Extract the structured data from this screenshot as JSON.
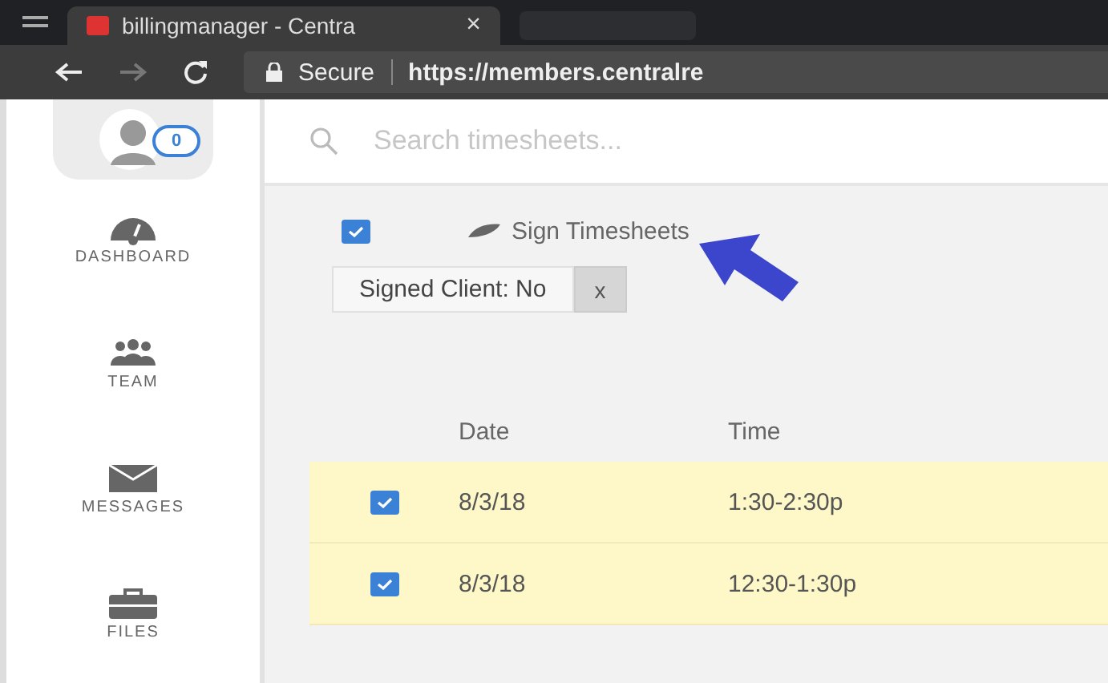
{
  "browser": {
    "tab_title": "billingmanager - Centra",
    "close": "×",
    "secure_label": "Secure",
    "url": "https://members.centralre"
  },
  "sidebar": {
    "badge": "0",
    "items": [
      {
        "label": "DASHBOARD",
        "kind": "gauge"
      },
      {
        "label": "TEAM",
        "kind": "team"
      },
      {
        "label": "MESSAGES",
        "kind": "mail"
      },
      {
        "label": "FILES",
        "kind": "briefcase"
      }
    ]
  },
  "search": {
    "placeholder": "Search timesheets..."
  },
  "toolbar": {
    "select_all": {
      "checked": true
    },
    "action": "Sign Timesheets"
  },
  "filter": {
    "label": "Signed Client: No",
    "remove": "x"
  },
  "table": {
    "columns": [
      "Date",
      "Time"
    ],
    "rows": [
      {
        "checked": true,
        "cells": [
          "8/3/18",
          "1:30-2:30p"
        ]
      },
      {
        "checked": true,
        "cells": [
          "8/3/18",
          "12:30-1:30p"
        ]
      }
    ]
  }
}
